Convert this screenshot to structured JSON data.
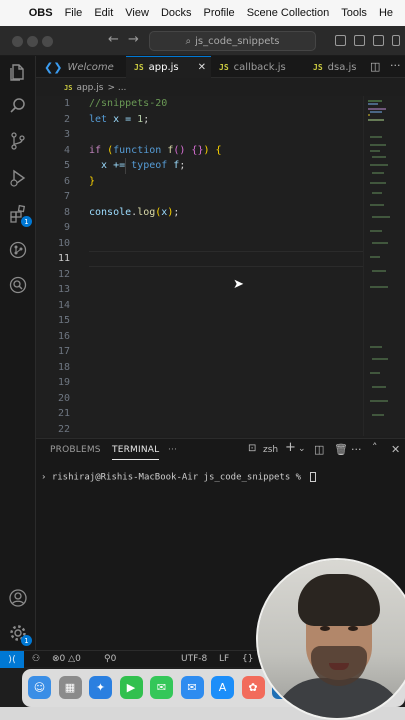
{
  "menubar": {
    "app": "OBS",
    "items": [
      "File",
      "Edit",
      "View",
      "Docks",
      "Profile",
      "Scene Collection",
      "Tools"
    ],
    "overflow": "He"
  },
  "titlebar": {
    "search_text": "js_code_snippets"
  },
  "tabs": [
    {
      "label": "Welcome",
      "icon": "vscode-logo-icon",
      "active": false
    },
    {
      "label": "app.js",
      "icon": "js-file-icon",
      "active": true
    },
    {
      "label": "callback.js",
      "icon": "js-file-icon",
      "active": false
    },
    {
      "label": "dsa.js",
      "icon": "js-file-icon",
      "active": false
    }
  ],
  "tab_file_badge": "JS",
  "breadcrumb": {
    "file": "app.js",
    "sep": "> ..."
  },
  "editor": {
    "line_numbers": [
      "1",
      "2",
      "3",
      "4",
      "5",
      "6",
      "7",
      "8",
      "9",
      "10",
      "11",
      "12",
      "13",
      "14",
      "15",
      "16",
      "17",
      "18",
      "19",
      "20",
      "21",
      "22"
    ],
    "current_line": 11,
    "lines": [
      [
        {
          "t": "//snippets-20",
          "c": "comment"
        }
      ],
      [
        {
          "t": "let",
          "c": "kw"
        },
        {
          "t": " x = ",
          "c": "var"
        },
        {
          "t": "1",
          "c": "num"
        },
        {
          "t": ";",
          "c": "punc"
        }
      ],
      [],
      [
        {
          "t": "if",
          "c": "ctrl"
        },
        {
          "t": " ",
          "c": "punc"
        },
        {
          "t": "(",
          "c": "br1"
        },
        {
          "t": "function",
          "c": "kw"
        },
        {
          "t": " ",
          "c": "punc"
        },
        {
          "t": "f",
          "c": "fn"
        },
        {
          "t": "()",
          "c": "br2"
        },
        {
          "t": " ",
          "c": "punc"
        },
        {
          "t": "{}",
          "c": "br2"
        },
        {
          "t": ")",
          "c": "br1"
        },
        {
          "t": " ",
          "c": "punc"
        },
        {
          "t": "{",
          "c": "br1"
        }
      ],
      [
        {
          "t": "  x += ",
          "c": "var"
        },
        {
          "t": "typeof",
          "c": "kw"
        },
        {
          "t": " f",
          "c": "var"
        },
        {
          "t": ";",
          "c": "punc"
        }
      ],
      [
        {
          "t": "}",
          "c": "br1"
        }
      ],
      [],
      [
        {
          "t": "console",
          "c": "var"
        },
        {
          "t": ".",
          "c": "punc"
        },
        {
          "t": "log",
          "c": "fn"
        },
        {
          "t": "(",
          "c": "br1"
        },
        {
          "t": "x",
          "c": "var"
        },
        {
          "t": ")",
          "c": "br1"
        },
        {
          "t": ";",
          "c": "punc"
        }
      ],
      [],
      [],
      [],
      [],
      [],
      [],
      [],
      [],
      [],
      [],
      [],
      [],
      [],
      []
    ]
  },
  "panel": {
    "tabs": [
      "PROBLEMS",
      "TERMINAL",
      "···"
    ],
    "active_tab": "TERMINAL",
    "shell": "zsh",
    "prompt": "rishiraj@Rishis-MacBook-Air js_code_snippets % "
  },
  "statusbar": {
    "errors": "0",
    "warnings": "0",
    "ports": "0",
    "encoding": "UTF-8",
    "eol": "LF",
    "lang_icon": "{}"
  },
  "dock_apps": [
    {
      "name": "finder-icon",
      "color": "#3a8ee6"
    },
    {
      "name": "launchpad-icon",
      "color": "#8b8b8b"
    },
    {
      "name": "safari-icon",
      "color": "#2a7fe0"
    },
    {
      "name": "facetime-icon",
      "color": "#31c04e"
    },
    {
      "name": "messages-icon",
      "color": "#34c759"
    },
    {
      "name": "mail-icon",
      "color": "#2e8cf0"
    },
    {
      "name": "appstore-icon",
      "color": "#1c8ef9"
    },
    {
      "name": "photos-icon",
      "color": "#f26b5b"
    },
    {
      "name": "vscode-icon",
      "color": "#1f6fb5"
    },
    {
      "name": "terminal-icon",
      "color": "#333333"
    }
  ]
}
